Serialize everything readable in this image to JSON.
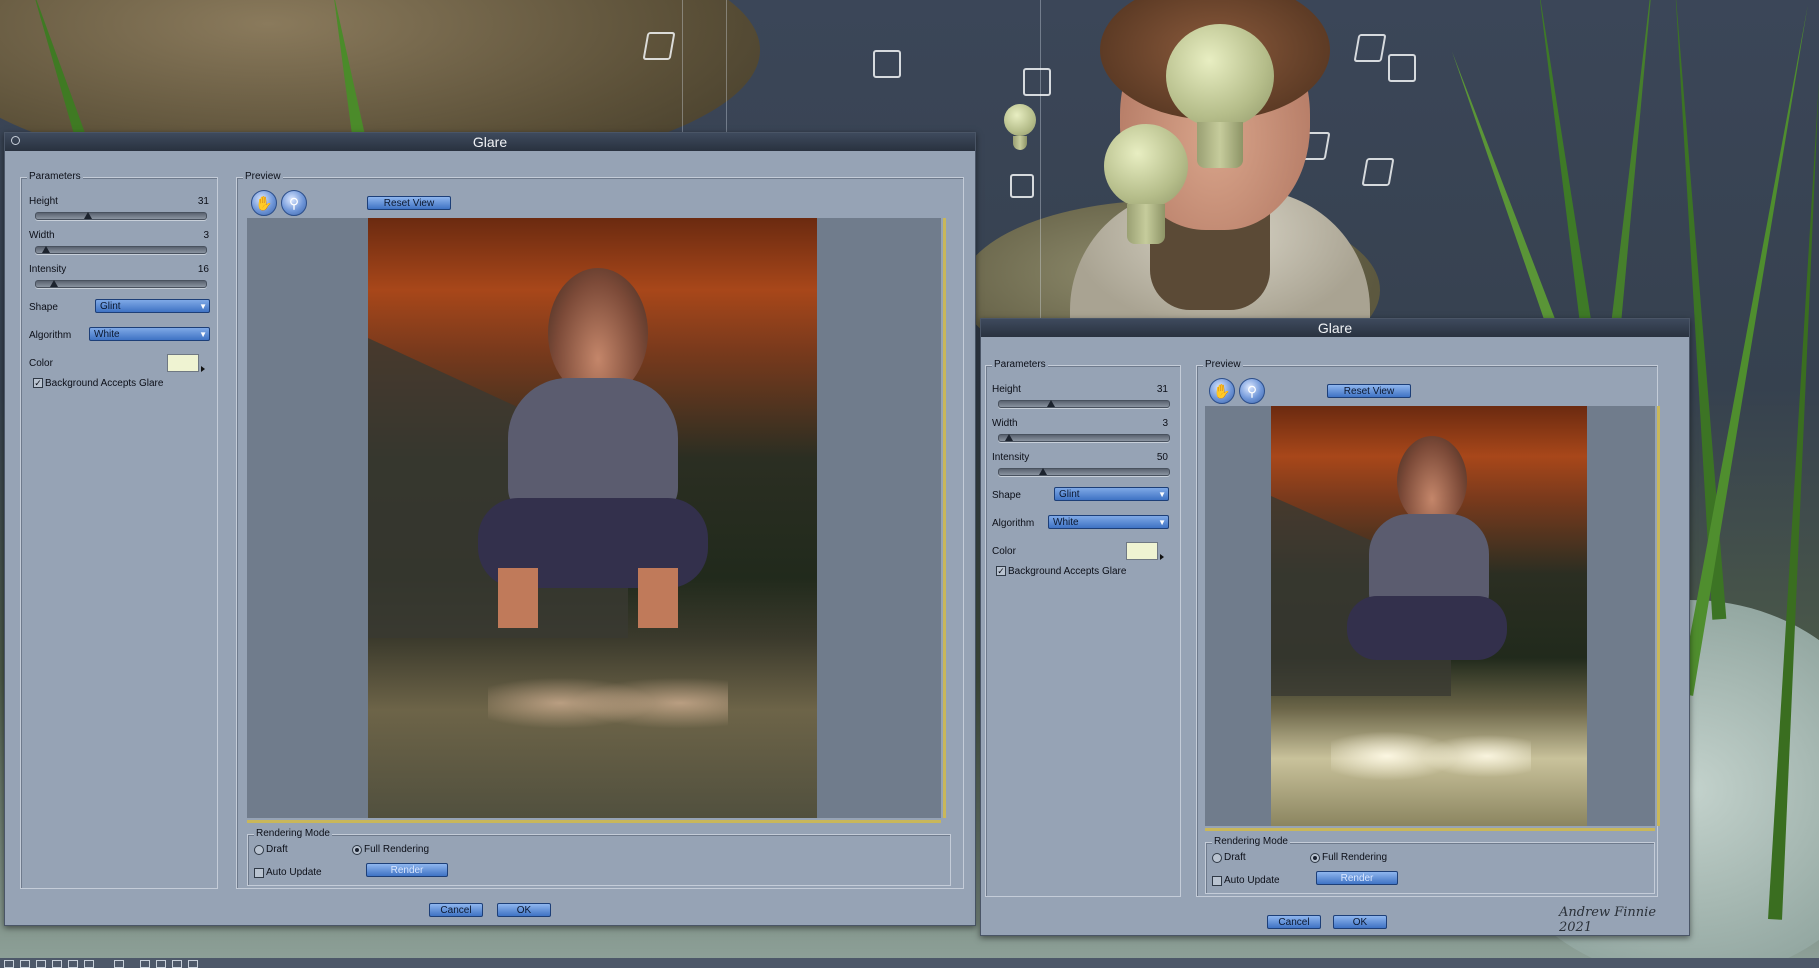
{
  "dialog_left": {
    "title": "Glare",
    "parameters_label": "Parameters",
    "height_label": "Height",
    "height_value": "31",
    "height_fraction": 0.31,
    "width_label": "Width",
    "width_value": "3",
    "width_fraction": 0.04,
    "intensity_label": "Intensity",
    "intensity_value": "16",
    "intensity_fraction": 0.11,
    "shape_label": "Shape",
    "shape_value": "Glint",
    "algorithm_label": "Algorithm",
    "algorithm_value": "White",
    "color_label": "Color",
    "color_value": "#eff3d2",
    "bg_glare_label": "Background Accepts Glare",
    "bg_glare_checked": true,
    "preview_label": "Preview",
    "reset_view": "Reset View",
    "rendering_mode_label": "Rendering Mode",
    "draft_label": "Draft",
    "full_rendering_label": "Full Rendering",
    "auto_update_label": "Auto Update",
    "render_button": "Render",
    "cancel_button": "Cancel",
    "ok_button": "OK",
    "hand_icon": "hand-icon",
    "zoom_icon": "magnifier-icon"
  },
  "dialog_right": {
    "title": "Glare",
    "parameters_label": "Parameters",
    "height_label": "Height",
    "height_value": "31",
    "height_fraction": 0.31,
    "width_label": "Width",
    "width_value": "3",
    "width_fraction": 0.04,
    "intensity_label": "Intensity",
    "intensity_value": "50",
    "intensity_fraction": 0.25,
    "shape_label": "Shape",
    "shape_value": "Glint",
    "algorithm_label": "Algorithm",
    "algorithm_value": "White",
    "color_label": "Color",
    "color_value": "#eff3d2",
    "bg_glare_label": "Background Accepts Glare",
    "bg_glare_checked": true,
    "preview_label": "Preview",
    "reset_view": "Reset View",
    "rendering_mode_label": "Rendering Mode",
    "draft_label": "Draft",
    "full_rendering_label": "Full Rendering",
    "auto_update_label": "Auto Update",
    "render_button": "Render",
    "cancel_button": "Cancel",
    "ok_button": "OK"
  },
  "signature": "Andrew Finnie 2021",
  "colors": {
    "dialog_bg": "#96a3b5",
    "titlebar": "#2f3847",
    "button_blue": "#4f82d0",
    "sky_orange": "#9c3a12"
  }
}
